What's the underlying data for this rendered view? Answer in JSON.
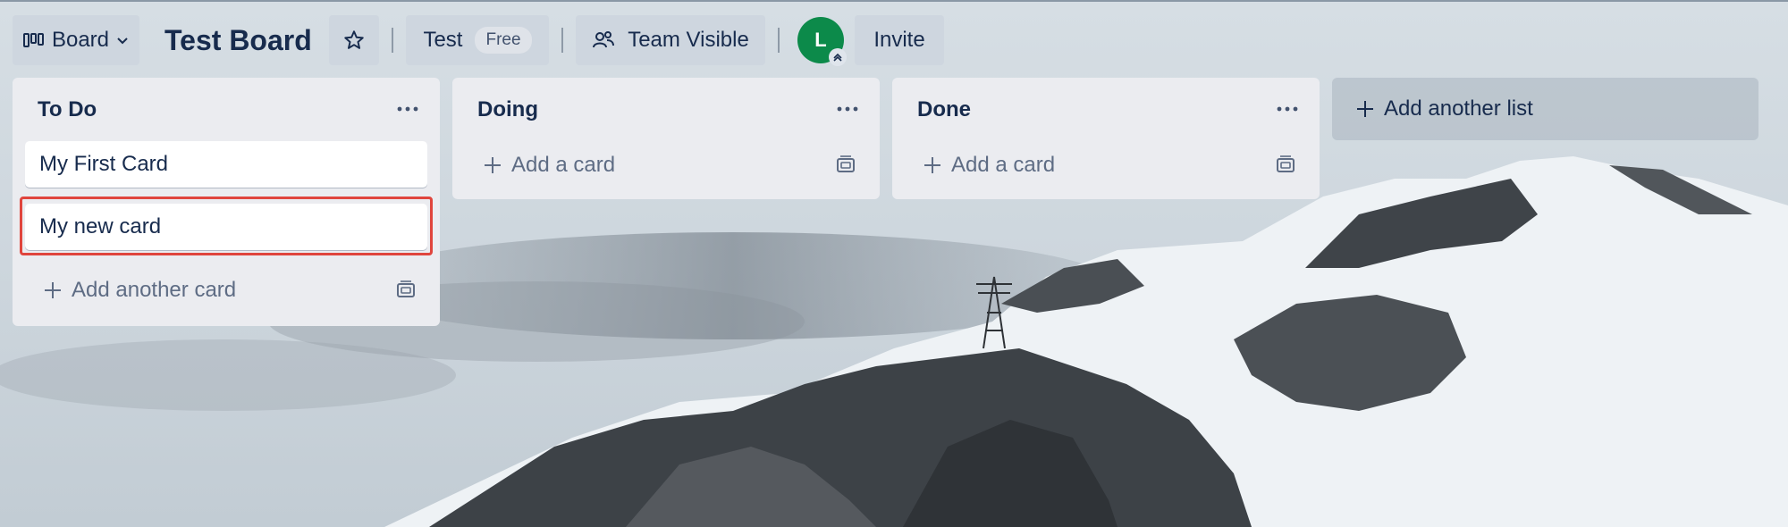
{
  "header": {
    "view_switcher_label": "Board",
    "board_title": "Test Board",
    "workspace": {
      "name": "Test",
      "plan_badge": "Free"
    },
    "visibility_label": "Team Visible",
    "member_avatar_initial": "L",
    "invite_label": "Invite"
  },
  "lists": [
    {
      "title": "To Do",
      "cards": [
        "My First Card",
        "My new card"
      ],
      "add_label": "Add another card",
      "highlighted_card": 1
    },
    {
      "title": "Doing",
      "cards": [],
      "add_label": "Add a card"
    },
    {
      "title": "Done",
      "cards": [],
      "add_label": "Add a card"
    }
  ],
  "add_list_label": "Add another list",
  "colors": {
    "avatar": "#0c8a4a",
    "highlight": "#e0453d",
    "list_bg": "#ebecf0"
  }
}
